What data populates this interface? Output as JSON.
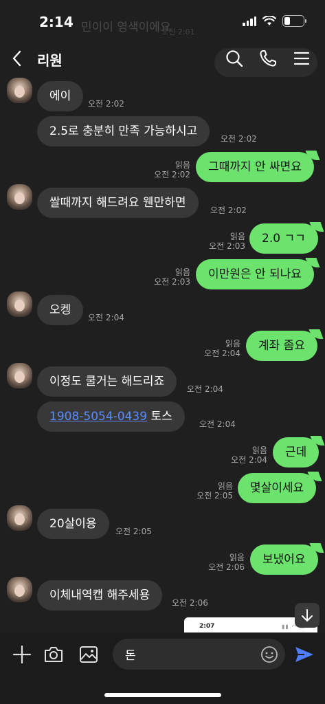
{
  "status_bar": {
    "time": "2:14",
    "ghost_text": "민이이 영색이에요",
    "ghost_time": "오전 2:01"
  },
  "header": {
    "title": "리원",
    "icons": [
      "back-icon",
      "search-icon",
      "phone-icon",
      "menu-icon"
    ]
  },
  "messages": [
    {
      "dir": "in",
      "avatar": true,
      "text": "에이",
      "time": "오전 2:02"
    },
    {
      "dir": "in",
      "avatar": false,
      "text": "2.5로 충분히 만족 가능하시고",
      "time": "오전 2:02"
    },
    {
      "dir": "out",
      "read": "읽음",
      "text": "그때까지 안 싸면요",
      "time": "오전 2:02"
    },
    {
      "dir": "in",
      "avatar": true,
      "text": "쌀때까지 해드려요 웬만하면",
      "time": "오전 2:02"
    },
    {
      "dir": "out",
      "read": "읽음",
      "text": "2.0 ㄱㄱ",
      "time": "오전 2:03"
    },
    {
      "dir": "out",
      "read": "읽음",
      "text": "이만원은 안 되나요",
      "time": "오전 2:03"
    },
    {
      "dir": "in",
      "avatar": true,
      "text": "오켕",
      "time": "오전 2:04"
    },
    {
      "dir": "out",
      "read": "읽음",
      "text": "계좌 좀요",
      "time": "오전 2:04"
    },
    {
      "dir": "in",
      "avatar": true,
      "text": "이정도 쿨거는 해드리죠",
      "time": "오전 2:04"
    },
    {
      "dir": "in",
      "avatar": false,
      "link": "1908-5054-0439",
      "text": " 토스",
      "time": "오전 2:04"
    },
    {
      "dir": "out",
      "read": "읽음",
      "text": "근데",
      "time": "오전 2:04"
    },
    {
      "dir": "out",
      "read": "읽음",
      "text": "몇살이세요",
      "time": "오전 2:05"
    },
    {
      "dir": "in",
      "avatar": true,
      "text": "20살이용",
      "time": "오전 2:05"
    },
    {
      "dir": "out",
      "read": "읽음",
      "text": "보냈어요",
      "time": "오전 2:06"
    },
    {
      "dir": "in",
      "avatar": true,
      "text": "이체내역캡 해주세용",
      "time": "오전 2:06"
    }
  ],
  "preview": {
    "time": "2:07"
  },
  "composer": {
    "value": "돈",
    "icons": [
      "plus-icon",
      "camera-icon",
      "gallery-icon",
      "emoji-icon",
      "send-icon"
    ]
  },
  "colors": {
    "background": "#1f1f1f",
    "bubble_in": "#383838",
    "bubble_out": "#6ce36d",
    "send": "#4f7dff"
  }
}
